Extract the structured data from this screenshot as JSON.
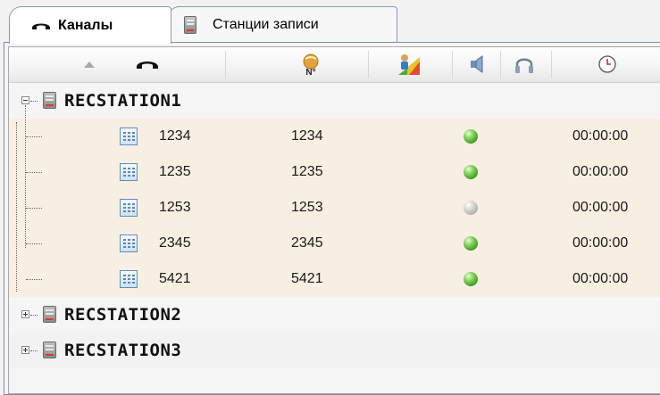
{
  "tabs": {
    "channels_label": "Каналы",
    "stations_label": "Станции записи"
  },
  "header": {
    "columns": [
      "sort-ascending-icon",
      "handset-icon",
      "number-icon",
      "user-level-icon",
      "speaker-icon",
      "headphones-icon",
      "clock-icon"
    ]
  },
  "tree": {
    "stations": [
      {
        "name": "RECSTATION1",
        "expanded": true,
        "channels": [
          {
            "name": "1234",
            "number": "1234",
            "status": "green",
            "time": "00:00:00"
          },
          {
            "name": "1235",
            "number": "1235",
            "status": "green",
            "time": "00:00:00"
          },
          {
            "name": "1253",
            "number": "1253",
            "status": "grey",
            "time": "00:00:00"
          },
          {
            "name": "2345",
            "number": "2345",
            "status": "green",
            "time": "00:00:00"
          },
          {
            "name": "5421",
            "number": "5421",
            "status": "green",
            "time": "00:00:00"
          }
        ]
      },
      {
        "name": "RECSTATION2",
        "expanded": false
      },
      {
        "name": "RECSTATION3",
        "expanded": false
      }
    ]
  },
  "colors": {
    "channel_row_bg": "#f7efe2",
    "led_active": "#5cbf2a",
    "led_inactive": "#bcbcbc",
    "tab_border": "#8c9aaf"
  }
}
